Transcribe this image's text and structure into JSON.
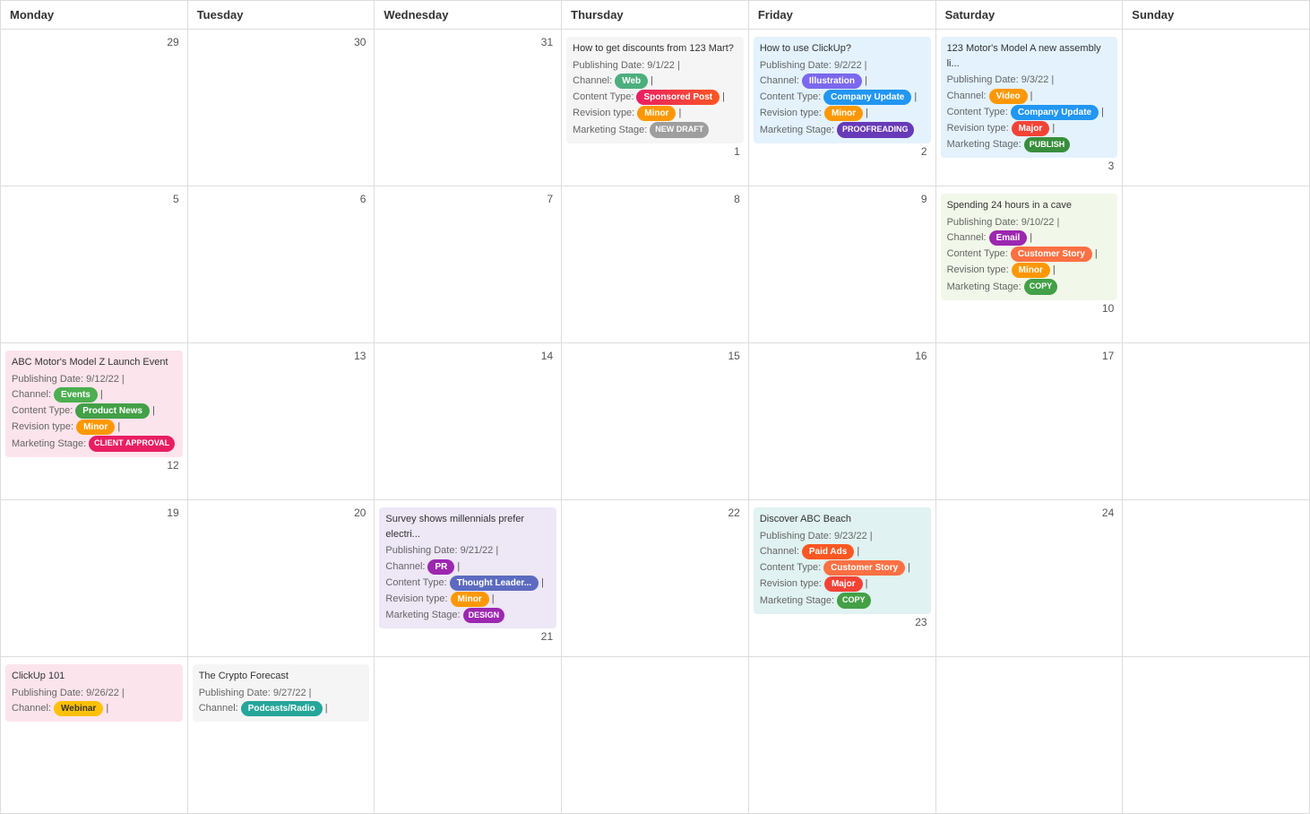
{
  "headers": [
    "Monday",
    "Tuesday",
    "Wednesday",
    "Thursday",
    "Friday",
    "Saturday",
    "Sunday"
  ],
  "rows": [
    {
      "cells": [
        {
          "number": "",
          "events": []
        },
        {
          "number": "",
          "events": []
        },
        {
          "number": "",
          "events": []
        },
        {
          "number": "",
          "events": [
            {
              "title": "How to get discounts from 123 Mart?",
              "publishDate": "9/1/22",
              "channel": "Web",
              "channelBadge": "badge-web",
              "contentType": "Sponsored Post",
              "contentBadge": "badge-sponsored",
              "revisionType": "Minor",
              "revisionBadge": "badge-minor",
              "marketingStage": "NEW DRAFT",
              "stageBadge": "badge-new-draft",
              "cardColor": "card-gray"
            }
          ]
        },
        {
          "number": "",
          "events": [
            {
              "title": "How to use ClickUp?",
              "publishDate": "9/2/22",
              "channel": "Illustration",
              "channelBadge": "badge-illustration",
              "contentType": "Company Update",
              "contentBadge": "badge-company-update",
              "revisionType": "Minor",
              "revisionBadge": "badge-minor",
              "marketingStage": "PROOFREADING",
              "stageBadge": "badge-proofreading",
              "cardColor": "card-blue"
            }
          ]
        },
        {
          "number": "",
          "events": [
            {
              "title": "123 Motor's Model A new assembly li...",
              "publishDate": "9/3/22",
              "channel": "Video",
              "channelBadge": "badge-video",
              "contentType": "Company Update",
              "contentBadge": "badge-company-update",
              "revisionType": "Major",
              "revisionBadge": "badge-major",
              "marketingStage": "PUBLISH",
              "stageBadge": "badge-publish",
              "cardColor": "card-blue"
            }
          ]
        },
        {
          "number": "",
          "events": []
        }
      ],
      "dayNumbers": [
        "29",
        "30",
        "31",
        "1",
        "2",
        "3",
        ""
      ]
    },
    {
      "cells": [
        {
          "events": []
        },
        {
          "events": []
        },
        {
          "events": []
        },
        {
          "events": []
        },
        {
          "events": []
        },
        {
          "events": [
            {
              "title": "Spending 24 hours in a cave",
              "publishDate": "9/10/22",
              "channel": "Email",
              "channelBadge": "badge-email",
              "contentType": "Customer Story",
              "contentBadge": "badge-customer-story",
              "revisionType": "Minor",
              "revisionBadge": "badge-minor",
              "marketingStage": "COPY",
              "stageBadge": "badge-copy",
              "cardColor": "card-light-green"
            }
          ]
        },
        {
          "events": []
        }
      ],
      "dayNumbers": [
        "5",
        "6",
        "7",
        "8",
        "9",
        "10",
        ""
      ]
    },
    {
      "cells": [
        {
          "events": [
            {
              "title": "ABC Motor's Model Z Launch Event",
              "publishDate": "9/12/22",
              "channel": "Events",
              "channelBadge": "badge-events",
              "contentType": "Product News",
              "contentBadge": "badge-product-news",
              "revisionType": "Minor",
              "revisionBadge": "badge-minor",
              "marketingStage": "CLIENT APPROVAL",
              "stageBadge": "badge-client-approval",
              "cardColor": "card-pink"
            }
          ]
        },
        {
          "events": []
        },
        {
          "events": []
        },
        {
          "events": []
        },
        {
          "events": []
        },
        {
          "events": []
        },
        {
          "events": []
        }
      ],
      "dayNumbers": [
        "12",
        "13",
        "14",
        "15",
        "16",
        "17",
        ""
      ]
    },
    {
      "cells": [
        {
          "events": []
        },
        {
          "events": []
        },
        {
          "events": [
            {
              "title": "Survey shows millennials prefer electri...",
              "publishDate": "9/21/22",
              "channel": "PR",
              "channelBadge": "badge-pr",
              "contentType": "Thought Leader...",
              "contentBadge": "badge-thought-leader",
              "revisionType": "Minor",
              "revisionBadge": "badge-minor",
              "marketingStage": "DESIGN",
              "stageBadge": "badge-design",
              "cardColor": "card-purple"
            }
          ]
        },
        {
          "events": []
        },
        {
          "events": [
            {
              "title": "Discover ABC Beach",
              "publishDate": "9/23/22",
              "channel": "Paid Ads",
              "channelBadge": "badge-paid-ads",
              "contentType": "Customer Story",
              "contentBadge": "badge-customer-story",
              "revisionType": "Major",
              "revisionBadge": "badge-major",
              "marketingStage": "COPY",
              "stageBadge": "badge-copy",
              "cardColor": "card-teal"
            }
          ]
        },
        {
          "events": []
        },
        {
          "events": []
        }
      ],
      "dayNumbers": [
        "19",
        "20",
        "21",
        "22",
        "23",
        "24",
        ""
      ]
    },
    {
      "cells": [
        {
          "events": [
            {
              "title": "ClickUp 101",
              "publishDate": "9/26/22",
              "channel": "Webinar",
              "channelBadge": "badge-webinar",
              "contentType": "",
              "contentBadge": "",
              "revisionType": "",
              "revisionBadge": "",
              "marketingStage": "",
              "stageBadge": "",
              "cardColor": "card-pink",
              "partial": true
            }
          ]
        },
        {
          "events": [
            {
              "title": "The Crypto Forecast",
              "publishDate": "9/27/22",
              "channel": "Podcasts/Radio",
              "channelBadge": "badge-podcasts",
              "contentType": "",
              "contentBadge": "",
              "revisionType": "",
              "revisionBadge": "",
              "marketingStage": "",
              "stageBadge": "",
              "cardColor": "card-gray",
              "partial": true
            }
          ]
        },
        {
          "events": []
        },
        {
          "events": []
        },
        {
          "events": []
        },
        {
          "events": []
        },
        {
          "events": []
        }
      ],
      "dayNumbers": [
        "",
        "",
        "",
        "",
        "",
        "",
        ""
      ]
    }
  ]
}
